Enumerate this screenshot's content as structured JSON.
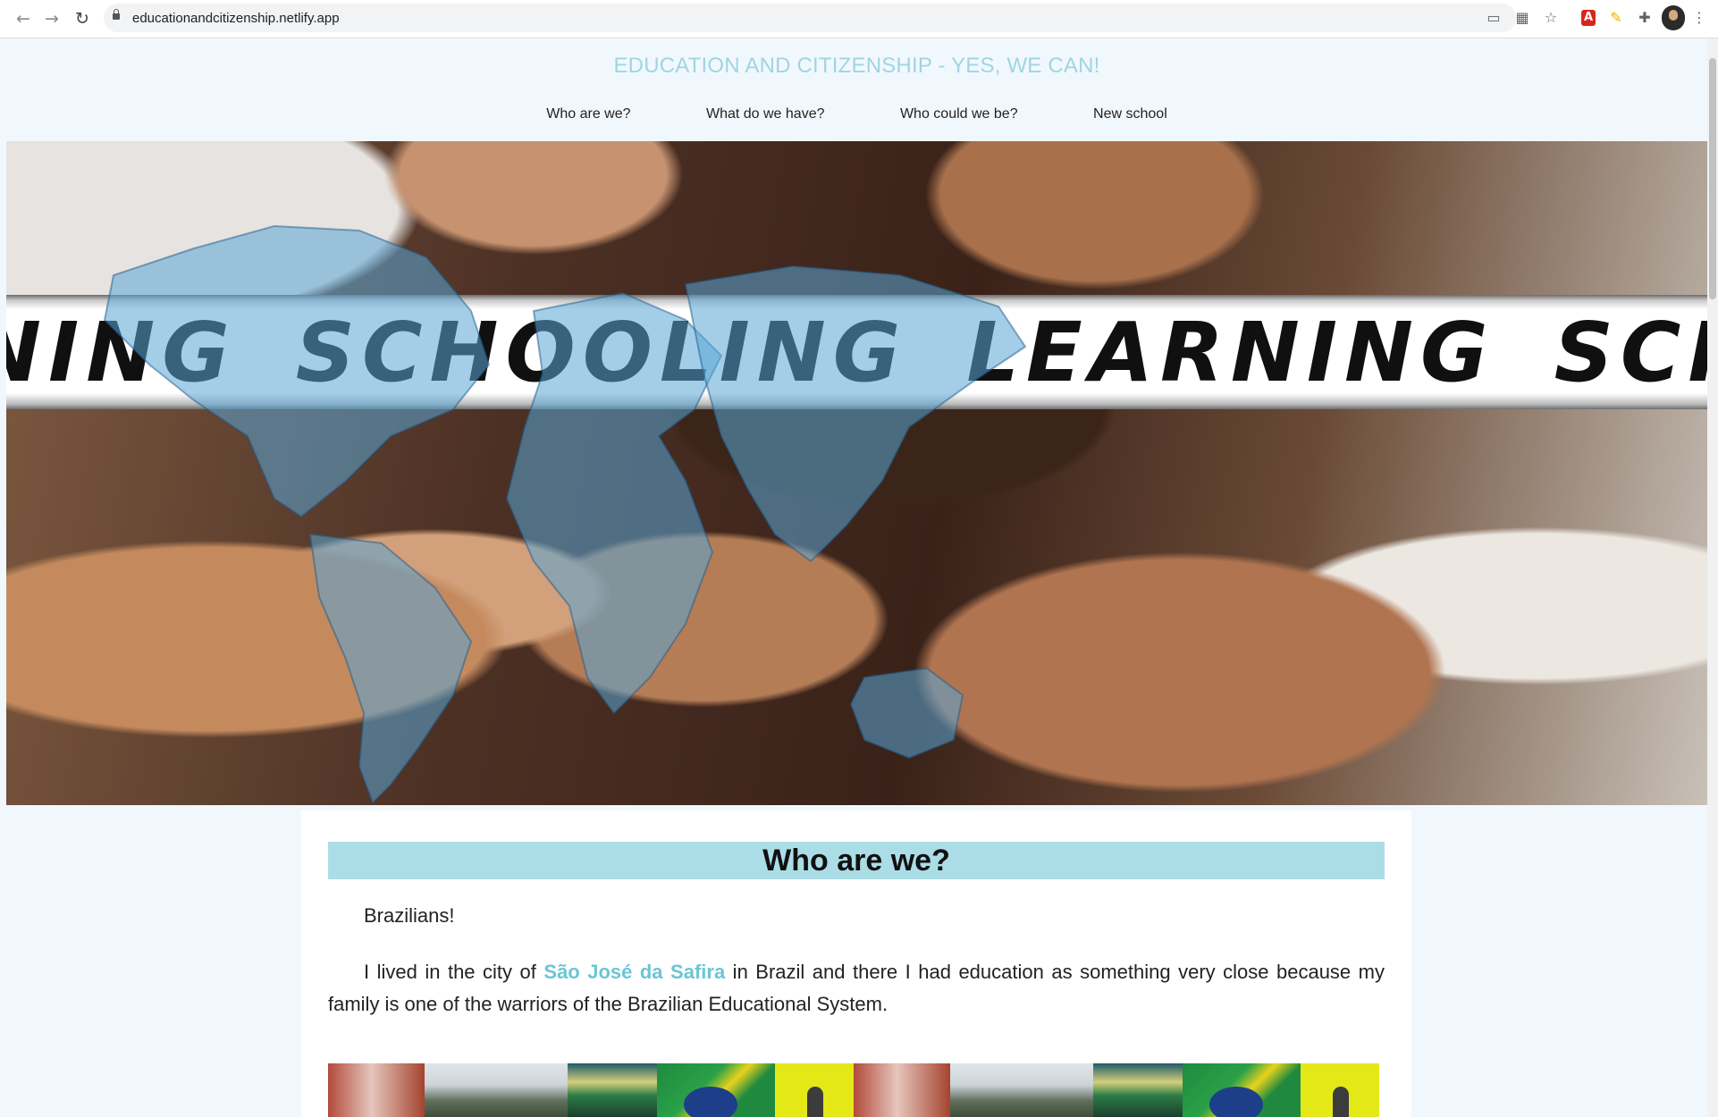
{
  "browser": {
    "url": "educationandcitizenship.netlify.app",
    "back_icon": "←",
    "forward_icon": "→",
    "reload_icon": "↻",
    "extensions": [
      {
        "name": "cast-icon",
        "glyph": "▭"
      },
      {
        "name": "qr-icon",
        "glyph": "▦"
      },
      {
        "name": "star-icon",
        "glyph": "☆"
      },
      {
        "name": "pdf-icon",
        "glyph": "A"
      },
      {
        "name": "highlighter-icon",
        "glyph": "✎"
      },
      {
        "name": "puzzle-icon",
        "glyph": "✚"
      },
      {
        "name": "menu-icon",
        "glyph": "⋮"
      }
    ]
  },
  "site": {
    "title": "EDUCATION AND CITIZENSHIP - YES, WE CAN!",
    "nav": [
      "Who are we?",
      "What do we have?",
      "Who could we be?",
      "New school"
    ]
  },
  "hero": {
    "words": [
      "NING",
      "SCHOOLING",
      "LEARNING",
      "SCHOOL"
    ]
  },
  "main": {
    "heading": "Who are we?",
    "paragraph1": "Brazilians!",
    "paragraph2_before": "I lived in the city of ",
    "paragraph2_link": "São José da Safira",
    "paragraph2_after": " in Brazil and there I had education as something very close because my family is one of the warriors of the Brazilian Educational System."
  },
  "colors": {
    "page_background": "#f1f8fd",
    "title": "#9fd5e2",
    "heading_band": "#abdde6",
    "link": "#6cc5d5"
  }
}
